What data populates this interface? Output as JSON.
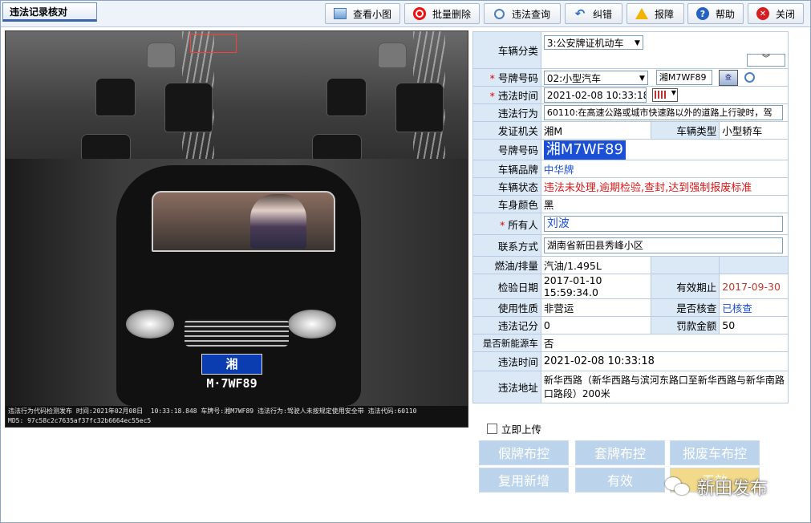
{
  "tab_title": "违法记录核对",
  "toolbar": [
    {
      "label": "查看小图",
      "icon": "picture-icon"
    },
    {
      "label": "批量删除",
      "icon": "stop-icon"
    },
    {
      "label": "违法查询",
      "icon": "search-icon"
    },
    {
      "label": "纠错",
      "icon": "undo-icon"
    },
    {
      "label": "报障",
      "icon": "warning-icon"
    },
    {
      "label": "帮助",
      "icon": "help-icon"
    },
    {
      "label": "关闭",
      "icon": "close-icon"
    }
  ],
  "image": {
    "plate_text": "湘M·7WF89",
    "caption_line1": "违法行为代码检测发布 时间:2021年02月08日  10:33:18.848 车牌号:湘M7WF89 违法行为:驾驶人未按规定使用安全带 违法代码:60110",
    "caption_line2": "MD5: 97c58c2c7635af37fc32b6664ec55ec5"
  },
  "form": {
    "vehicle_category_label": "车辆分类",
    "vehicle_category_value": "3:公安牌证机动车",
    "expand_icon": "double-chevron-down-icon",
    "plate_no_label": "号牌号码",
    "plate_type_value": "02:小型汽车",
    "plate_no_value": "湘M7WF89",
    "violation_time_label": "违法时间",
    "violation_time_value": "2021-02-08 10:33:18",
    "violation_act_label": "违法行为",
    "violation_act_value": "60110:在高速公路或城市快速路以外的道路上行驶时，驾",
    "issuing_label": "发证机关",
    "issuing_value": "湘M",
    "vehicle_type_label": "车辆类型",
    "vehicle_type_value": "小型轿车",
    "plate_no2_label": "号牌号码",
    "plate_no2_value": "湘M7WF89",
    "brand_label": "车辆品牌",
    "brand_value": "中华牌",
    "status_label": "车辆状态",
    "status_value": "违法未处理,逾期检验,查封,达到强制报废标准",
    "color_label": "车身颜色",
    "color_value": "黑",
    "owner_label": "所有人",
    "owner_value": "刘波",
    "contact_label": "联系方式",
    "contact_value": "湖南省新田县秀峰小区",
    "fuel_label": "燃油/排量",
    "fuel_value": "汽油/1.495L",
    "inspect_date_label": "检验日期",
    "inspect_date_value": "2017-01-10 15:59:34.0",
    "valid_until_label": "有效期止",
    "valid_until_value": "2017-09-30",
    "usage_label": "使用性质",
    "usage_value": "非营运",
    "verified_label": "是否核查",
    "verified_value": "已核查",
    "points_label": "违法记分",
    "points_value": "0",
    "fine_label": "罚款金额",
    "fine_value": "50",
    "new_energy_label": "是否新能源车",
    "new_energy_value": "否",
    "violation_time2_label": "违法时间",
    "violation_time2_value": "2021-02-08 10:33:18",
    "address_label": "违法地址",
    "address_value": "新华西路（新华西路与滨河东路口至新华西路与新华南路口路段）200米"
  },
  "upload_label": "立即上传",
  "actions": {
    "fake_plate": "假牌布控",
    "cloned_plate": "套牌布控",
    "scrap_vehicle": "报废车布控",
    "reuse_add": "复用新增",
    "valid": "有效",
    "invalid": "无效"
  },
  "watermark": "新田发布"
}
